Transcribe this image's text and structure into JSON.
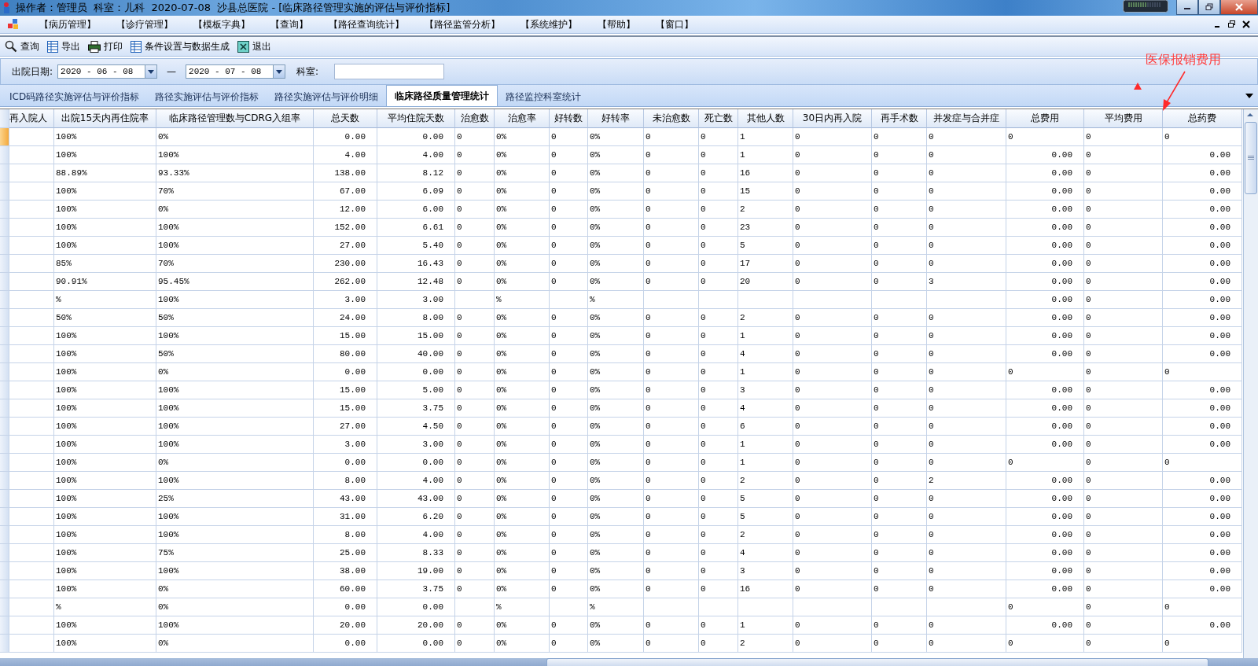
{
  "window": {
    "title": "操作者：管理员  科室：儿科  2020-07-08  沙县总医院 - [临床路径管理实施的评估与评价指标]"
  },
  "menu": [
    "【病历管理】",
    "【诊疗管理】",
    "【模板字典】",
    "【查询】",
    "【路径查询统计】",
    "【路径监管分析】",
    "【系统维护】",
    "【帮助】",
    "【窗口】"
  ],
  "toolbar": [
    {
      "label": "查询",
      "kind": "search"
    },
    {
      "label": "导出",
      "kind": "sheet"
    },
    {
      "label": "打印",
      "kind": "print"
    },
    {
      "label": "条件设置与数据生成",
      "kind": "sheet"
    },
    {
      "label": "退出",
      "kind": "exit"
    }
  ],
  "filter": {
    "date_label": "出院日期:",
    "date_from": "2020 - 06 - 08",
    "separator": "—",
    "date_to": "2020 - 07 - 08",
    "dept_label": "科室:"
  },
  "tabs": [
    {
      "label": "ICD码路径实施评估与评价指标",
      "selected": false
    },
    {
      "label": "路径实施评估与评价指标",
      "selected": false
    },
    {
      "label": "路径实施评估与评价明细",
      "selected": false
    },
    {
      "label": "临床路径质量管理统计",
      "selected": true
    },
    {
      "label": "路径监控科室统计",
      "selected": false
    }
  ],
  "annotation": {
    "text": "医保报销费用"
  },
  "table": {
    "columns": [
      {
        "label": "再入院人",
        "kind": "text"
      },
      {
        "label": "出院15天内再住院率",
        "kind": "text"
      },
      {
        "label": "临床路径管理数与CDRG入组率",
        "kind": "text"
      },
      {
        "label": "总天数",
        "kind": "amount"
      },
      {
        "label": "平均住院天数",
        "kind": "amount"
      },
      {
        "label": "治愈数",
        "kind": "text"
      },
      {
        "label": "治愈率",
        "kind": "text"
      },
      {
        "label": "好转数",
        "kind": "text"
      },
      {
        "label": "好转率",
        "kind": "text"
      },
      {
        "label": "未治愈数",
        "kind": "text"
      },
      {
        "label": "死亡数",
        "kind": "text"
      },
      {
        "label": "其他人数",
        "kind": "text"
      },
      {
        "label": "30日内再入院",
        "kind": "text"
      },
      {
        "label": "再手术数",
        "kind": "text"
      },
      {
        "label": "并发症与合并症",
        "kind": "text"
      },
      {
        "label": "总费用",
        "kind": "fee"
      },
      {
        "label": "平均费用",
        "kind": "text"
      },
      {
        "label": "总药费",
        "kind": "fee"
      }
    ],
    "rows": [
      {
        "selected": true,
        "kind": "plain",
        "cells": [
          null,
          "100%",
          "0%",
          "0.00",
          "0.00",
          "0",
          "0%",
          "0",
          "0%",
          "0",
          "0",
          "1",
          "0",
          "0",
          "0",
          "0",
          "0",
          "0"
        ]
      },
      {
        "selected": false,
        "kind": "amount",
        "cells": [
          null,
          "100%",
          "100%",
          "4.00",
          "4.00",
          "0",
          "0%",
          "0",
          "0%",
          "0",
          "0",
          "1",
          "0",
          "0",
          "0",
          "0.00",
          "0",
          "0.00"
        ]
      },
      {
        "selected": false,
        "kind": "amount",
        "cells": [
          null,
          "88.89%",
          "93.33%",
          "138.00",
          "8.12",
          "0",
          "0%",
          "0",
          "0%",
          "0",
          "0",
          "16",
          "0",
          "0",
          "0",
          "0.00",
          "0",
          "0.00"
        ]
      },
      {
        "selected": false,
        "kind": "amount",
        "cells": [
          null,
          "100%",
          "70%",
          "67.00",
          "6.09",
          "0",
          "0%",
          "0",
          "0%",
          "0",
          "0",
          "15",
          "0",
          "0",
          "0",
          "0.00",
          "0",
          "0.00"
        ]
      },
      {
        "selected": false,
        "kind": "amount",
        "cells": [
          null,
          "100%",
          "0%",
          "12.00",
          "6.00",
          "0",
          "0%",
          "0",
          "0%",
          "0",
          "0",
          "2",
          "0",
          "0",
          "0",
          "0.00",
          "0",
          "0.00"
        ]
      },
      {
        "selected": false,
        "kind": "amount",
        "cells": [
          null,
          "100%",
          "100%",
          "152.00",
          "6.61",
          "0",
          "0%",
          "0",
          "0%",
          "0",
          "0",
          "23",
          "0",
          "0",
          "0",
          "0.00",
          "0",
          "0.00"
        ]
      },
      {
        "selected": false,
        "kind": "amount",
        "cells": [
          null,
          "100%",
          "100%",
          "27.00",
          "5.40",
          "0",
          "0%",
          "0",
          "0%",
          "0",
          "0",
          "5",
          "0",
          "0",
          "0",
          "0.00",
          "0",
          "0.00"
        ]
      },
      {
        "selected": false,
        "kind": "amount",
        "cells": [
          null,
          "85%",
          "70%",
          "230.00",
          "16.43",
          "0",
          "0%",
          "0",
          "0%",
          "0",
          "0",
          "17",
          "0",
          "0",
          "0",
          "0.00",
          "0",
          "0.00"
        ]
      },
      {
        "selected": false,
        "kind": "amount",
        "cells": [
          null,
          "90.91%",
          "95.45%",
          "262.00",
          "12.48",
          "0",
          "0%",
          "0",
          "0%",
          "0",
          "0",
          "20",
          "0",
          "0",
          "3",
          "0.00",
          "0",
          "0.00"
        ]
      },
      {
        "selected": false,
        "kind": "amount",
        "cells": [
          null,
          "%",
          "100%",
          "3.00",
          "3.00",
          null,
          "%",
          null,
          "%",
          null,
          null,
          null,
          null,
          null,
          null,
          "0.00",
          "0",
          "0.00"
        ]
      },
      {
        "selected": false,
        "kind": "amount",
        "cells": [
          null,
          "50%",
          "50%",
          "24.00",
          "8.00",
          "0",
          "0%",
          "0",
          "0%",
          "0",
          "0",
          "2",
          "0",
          "0",
          "0",
          "0.00",
          "0",
          "0.00"
        ]
      },
      {
        "selected": false,
        "kind": "amount",
        "cells": [
          null,
          "100%",
          "100%",
          "15.00",
          "15.00",
          "0",
          "0%",
          "0",
          "0%",
          "0",
          "0",
          "1",
          "0",
          "0",
          "0",
          "0.00",
          "0",
          "0.00"
        ]
      },
      {
        "selected": false,
        "kind": "amount",
        "cells": [
          null,
          "100%",
          "50%",
          "80.00",
          "40.00",
          "0",
          "0%",
          "0",
          "0%",
          "0",
          "0",
          "4",
          "0",
          "0",
          "0",
          "0.00",
          "0",
          "0.00"
        ]
      },
      {
        "selected": false,
        "kind": "plain",
        "cells": [
          null,
          "100%",
          "0%",
          "0.00",
          "0.00",
          "0",
          "0%",
          "0",
          "0%",
          "0",
          "0",
          "1",
          "0",
          "0",
          "0",
          "0",
          "0",
          "0"
        ]
      },
      {
        "selected": false,
        "kind": "amount",
        "cells": [
          null,
          "100%",
          "100%",
          "15.00",
          "5.00",
          "0",
          "0%",
          "0",
          "0%",
          "0",
          "0",
          "3",
          "0",
          "0",
          "0",
          "0.00",
          "0",
          "0.00"
        ]
      },
      {
        "selected": false,
        "kind": "amount",
        "cells": [
          null,
          "100%",
          "100%",
          "15.00",
          "3.75",
          "0",
          "0%",
          "0",
          "0%",
          "0",
          "0",
          "4",
          "0",
          "0",
          "0",
          "0.00",
          "0",
          "0.00"
        ]
      },
      {
        "selected": false,
        "kind": "amount",
        "cells": [
          null,
          "100%",
          "100%",
          "27.00",
          "4.50",
          "0",
          "0%",
          "0",
          "0%",
          "0",
          "0",
          "6",
          "0",
          "0",
          "0",
          "0.00",
          "0",
          "0.00"
        ]
      },
      {
        "selected": false,
        "kind": "amount",
        "cells": [
          null,
          "100%",
          "100%",
          "3.00",
          "3.00",
          "0",
          "0%",
          "0",
          "0%",
          "0",
          "0",
          "1",
          "0",
          "0",
          "0",
          "0.00",
          "0",
          "0.00"
        ]
      },
      {
        "selected": false,
        "kind": "plain",
        "cells": [
          null,
          "100%",
          "0%",
          "0.00",
          "0.00",
          "0",
          "0%",
          "0",
          "0%",
          "0",
          "0",
          "1",
          "0",
          "0",
          "0",
          "0",
          "0",
          "0"
        ]
      },
      {
        "selected": false,
        "kind": "amount",
        "cells": [
          null,
          "100%",
          "100%",
          "8.00",
          "4.00",
          "0",
          "0%",
          "0",
          "0%",
          "0",
          "0",
          "2",
          "0",
          "0",
          "2",
          "0.00",
          "0",
          "0.00"
        ]
      },
      {
        "selected": false,
        "kind": "amount",
        "cells": [
          null,
          "100%",
          "25%",
          "43.00",
          "43.00",
          "0",
          "0%",
          "0",
          "0%",
          "0",
          "0",
          "5",
          "0",
          "0",
          "0",
          "0.00",
          "0",
          "0.00"
        ]
      },
      {
        "selected": false,
        "kind": "amount",
        "cells": [
          null,
          "100%",
          "100%",
          "31.00",
          "6.20",
          "0",
          "0%",
          "0",
          "0%",
          "0",
          "0",
          "5",
          "0",
          "0",
          "0",
          "0.00",
          "0",
          "0.00"
        ]
      },
      {
        "selected": false,
        "kind": "amount",
        "cells": [
          null,
          "100%",
          "100%",
          "8.00",
          "4.00",
          "0",
          "0%",
          "0",
          "0%",
          "0",
          "0",
          "2",
          "0",
          "0",
          "0",
          "0.00",
          "0",
          "0.00"
        ]
      },
      {
        "selected": false,
        "kind": "amount",
        "cells": [
          null,
          "100%",
          "75%",
          "25.00",
          "8.33",
          "0",
          "0%",
          "0",
          "0%",
          "0",
          "0",
          "4",
          "0",
          "0",
          "0",
          "0.00",
          "0",
          "0.00"
        ]
      },
      {
        "selected": false,
        "kind": "amount",
        "cells": [
          null,
          "100%",
          "100%",
          "38.00",
          "19.00",
          "0",
          "0%",
          "0",
          "0%",
          "0",
          "0",
          "3",
          "0",
          "0",
          "0",
          "0.00",
          "0",
          "0.00"
        ]
      },
      {
        "selected": false,
        "kind": "amount",
        "cells": [
          null,
          "100%",
          "0%",
          "60.00",
          "3.75",
          "0",
          "0%",
          "0",
          "0%",
          "0",
          "0",
          "16",
          "0",
          "0",
          "0",
          "0.00",
          "0",
          "0.00"
        ]
      },
      {
        "selected": false,
        "kind": "plain",
        "cells": [
          null,
          "%",
          "0%",
          "0.00",
          "0.00",
          null,
          "%",
          null,
          "%",
          null,
          null,
          null,
          null,
          null,
          null,
          "0",
          "0",
          "0"
        ]
      },
      {
        "selected": false,
        "kind": "amount",
        "cells": [
          null,
          "100%",
          "100%",
          "20.00",
          "20.00",
          "0",
          "0%",
          "0",
          "0%",
          "0",
          "0",
          "1",
          "0",
          "0",
          "0",
          "0.00",
          "0",
          "0.00"
        ]
      },
      {
        "selected": false,
        "kind": "plain",
        "cells": [
          null,
          "100%",
          "0%",
          "0.00",
          "0.00",
          "0",
          "0%",
          "0",
          "0%",
          "0",
          "0",
          "2",
          "0",
          "0",
          "0",
          "0",
          "0",
          "0"
        ]
      }
    ]
  }
}
